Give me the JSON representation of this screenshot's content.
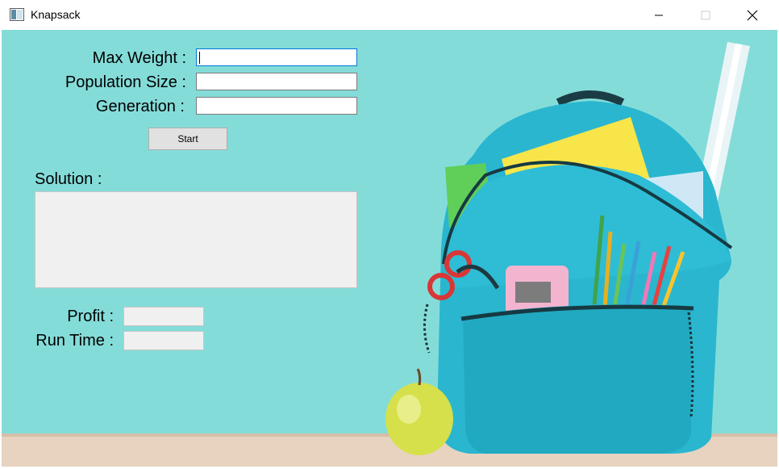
{
  "window": {
    "title": "Knapsack",
    "controls": {
      "minimize": "minimize-icon",
      "maximize": "maximize-icon",
      "close": "close-icon"
    }
  },
  "form": {
    "max_weight_label": "Max Weight :",
    "population_size_label": "Population Size :",
    "generation_label": "Generation :",
    "max_weight_value": "",
    "population_size_value": "",
    "generation_value": "",
    "start_label": "Start"
  },
  "results": {
    "solution_label": "Solution :",
    "solution_value": "",
    "profit_label": "Profit :",
    "profit_value": "",
    "run_time_label": "Run Time :",
    "run_time_value": ""
  },
  "colors": {
    "background": "#84dcd9",
    "backpack": "#2ab6cf",
    "focus_border": "#0078d7"
  }
}
